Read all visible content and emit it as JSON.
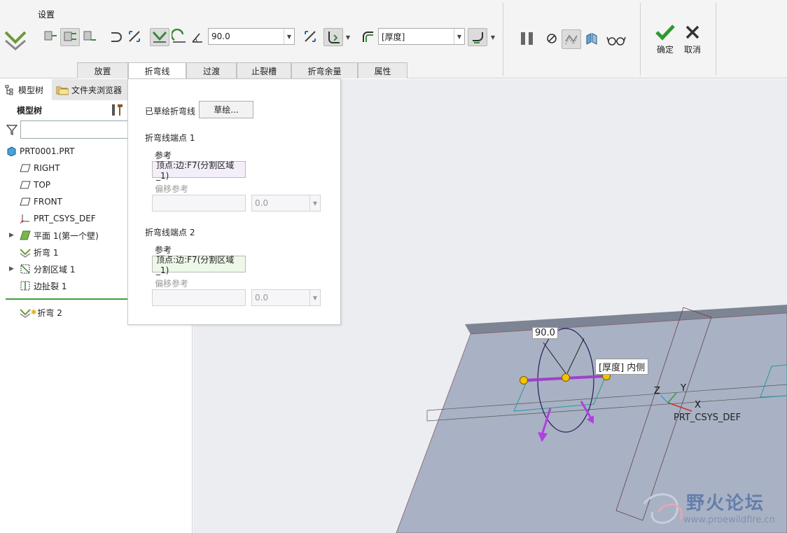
{
  "ribbon": {
    "section_title": "设置",
    "angle_value": "90.0",
    "thickness_option": "[厚度]",
    "tabs": [
      {
        "label": "放置"
      },
      {
        "label": "折弯线"
      },
      {
        "label": "过渡"
      },
      {
        "label": "止裂槽"
      },
      {
        "label": "折弯余量"
      },
      {
        "label": "属性"
      }
    ],
    "active_tab": "折弯线",
    "ok_label": "确定",
    "cancel_label": "取消",
    "colors": {
      "ok": "#2e9a2e",
      "cancel": "#333333"
    }
  },
  "left_panel": {
    "tab_model_tree": "模型树",
    "tab_folder_browser": "文件夹浏览器",
    "tree_header": "模型树",
    "search_placeholder": "",
    "items": [
      {
        "label": "PRT0001.PRT",
        "icon": "part-icon"
      },
      {
        "label": "RIGHT",
        "icon": "datum-plane-icon"
      },
      {
        "label": "TOP",
        "icon": "datum-plane-icon"
      },
      {
        "label": "FRONT",
        "icon": "datum-plane-icon"
      },
      {
        "label": "PRT_CSYS_DEF",
        "icon": "csys-icon"
      },
      {
        "label": "平面 1(第一个壁)",
        "icon": "flat-wall-icon"
      },
      {
        "label": "折弯 1",
        "icon": "bend-icon"
      },
      {
        "label": "分割区域 1",
        "icon": "split-area-icon"
      },
      {
        "label": "边扯裂 1",
        "icon": "edge-rip-icon"
      },
      {
        "label": "折弯 2",
        "icon": "bend-icon"
      }
    ]
  },
  "bend_line_panel": {
    "sketched_label": "已草绘折弯线",
    "sketch_button": "草绘...",
    "endpoint1_title": "折弯线端点 1",
    "endpoint2_title": "折弯线端点 2",
    "ref_label": "参考",
    "offset_ref_label": "偏移参考",
    "endpoint1_ref": "顶点:边:F7(分割区域_1)",
    "endpoint2_ref": "顶点:边:F7(分割区域_1)",
    "offset1_value": "0.0",
    "offset2_value": "0.0",
    "colors": {
      "ref1_bg": "#f3eefa",
      "ref2_bg": "#eef8e8"
    }
  },
  "viewport": {
    "angle_label": "90.0",
    "thickness_label": "[厚度]",
    "side_label": "内侧",
    "csys_z": "Z",
    "csys_y": "Y",
    "csys_x": "X",
    "csys_name": "PRT_CSYS_DEF",
    "watermark_title": "野火论坛",
    "watermark_url": "www.proewildfire.cn",
    "colors": {
      "sheet": "#a8b2c4",
      "edge": "#6b6f78",
      "bend_line": "#a040c8",
      "handle": "#f2c200"
    }
  }
}
